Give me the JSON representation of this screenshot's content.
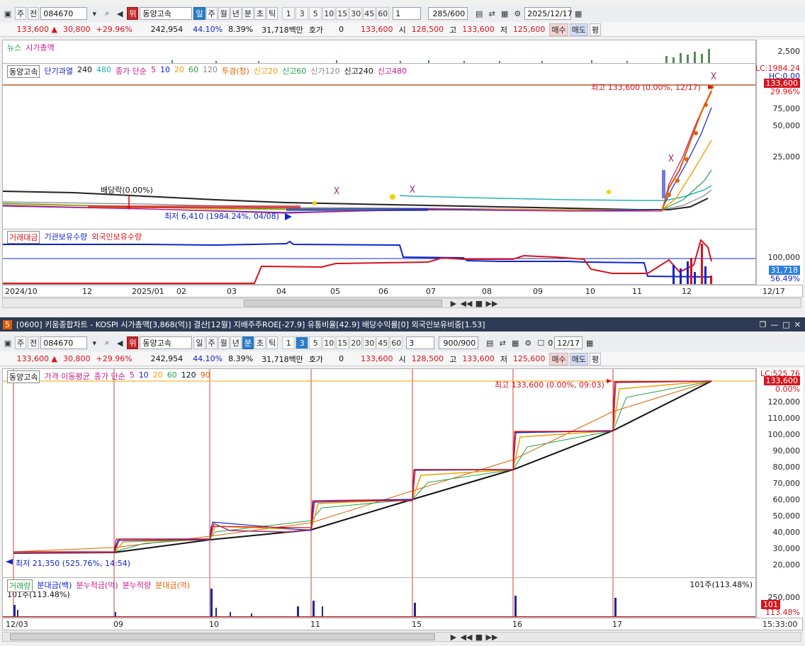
{
  "top": {
    "toolbar": {
      "market": "주",
      "mode": "전",
      "code": "084670",
      "warn": "위",
      "name": "동양고속",
      "periods": [
        "일",
        "주",
        "월",
        "년",
        "분",
        "초",
        "틱"
      ],
      "active_period": "일",
      "nums": [
        "1",
        "3",
        "5",
        "10",
        "15",
        "30",
        "45",
        "60"
      ],
      "interval": "1",
      "count": "285/600",
      "date": "2025/12/17"
    },
    "quote": {
      "price": "133,600",
      "change": "30,800",
      "pct": "+29.96%",
      "volume": "242,954",
      "ratio": "44.10%",
      "turnover": "8.39%",
      "amount": "31,718백만",
      "hoga_label": "호가",
      "hoga": "0",
      "ask": "133,600",
      "open_label": "시",
      "open": "128,500",
      "high_label": "고",
      "high": "133,600",
      "low_label": "저",
      "low": "125,600",
      "buy": "매수",
      "sell": "매도",
      "avg": "평"
    },
    "news_pane": {
      "legend": [
        "뉴스",
        "시가총액"
      ],
      "tick": "2,500"
    },
    "price_pane": {
      "legend": [
        "동양고속",
        "단기과열",
        "240",
        "480",
        "종가 단순",
        "5",
        "10",
        "20",
        "60",
        "120",
        "투경(청)",
        "신고20",
        "신고60",
        "신가120",
        "신고240",
        "신고480"
      ],
      "lc": "LC:1984.24",
      "hc": "HC:0.00",
      "last_price": "133,600",
      "last_pct": "29.96%",
      "ticks": [
        "75,000",
        "50,000",
        "25,000"
      ],
      "high_note": "최고 133,600 (0.00%, 12/17)",
      "low_note": "최저 6,410 (1984.24%, 04/08)",
      "div_note": "배당락(0.00%)"
    },
    "vol_pane": {
      "legend": [
        "거래대금",
        "기관보유수량",
        "외국인보유수량"
      ],
      "tick": "100,000",
      "val1": "31,718",
      "val2": "56.49%"
    },
    "xaxis": [
      "2024/10",
      "12",
      "2025/01",
      "02",
      "03",
      "04",
      "05",
      "06",
      "07",
      "08",
      "09",
      "10",
      "11",
      "12"
    ],
    "xaxis_end": "12/17",
    "colors": {
      "red": "#d8121c",
      "blue": "#1224c8",
      "black": "#111111",
      "teal": "#22b5b5",
      "orange": "#f08a00",
      "green": "#26a04a"
    }
  },
  "window": {
    "badge": "5",
    "title": "[0600] 키움종합차트 - KOSPI 시가총액[3,868(억)] 결산[12월] 지배주주ROE[-27.9] 유통비율[42.9] 배당수익률[0] 외국인보유비중[1.53]"
  },
  "bottom": {
    "toolbar": {
      "market": "주",
      "mode": "전",
      "code": "084670",
      "warn": "위",
      "name": "동양고속",
      "periods": [
        "일",
        "주",
        "월",
        "년",
        "분",
        "초",
        "틱"
      ],
      "active_period": "분",
      "nums": [
        "1",
        "3",
        "5",
        "10",
        "15",
        "20",
        "30",
        "45",
        "60"
      ],
      "active_num": "3",
      "interval": "3",
      "count": "900/900",
      "check_label": "0",
      "date": "12/17"
    },
    "quote": {
      "price": "133,600",
      "change": "30,800",
      "pct": "+29.96%",
      "volume": "242,954",
      "ratio": "44.10%",
      "turnover": "8.39%",
      "amount": "31,718백만",
      "hoga_label": "호가",
      "hoga": "0",
      "ask": "133,600",
      "open_label": "시",
      "open": "128,500",
      "high_label": "고",
      "high": "133,600",
      "low_label": "저",
      "low": "125,600",
      "buy": "매수",
      "sell": "매도",
      "avg": "평"
    },
    "price_pane": {
      "legend": [
        "동양고속",
        "가격 이동평균",
        "종가 단순",
        "5",
        "10",
        "20",
        "60",
        "120",
        "90"
      ],
      "lc": "LC:525.76",
      "last_price": "133,600",
      "last_pct": "0.00%",
      "ticks": [
        "120,000",
        "110,000",
        "100,000",
        "90,000",
        "80,000",
        "70,000",
        "60,000",
        "50,000",
        "40,000",
        "30,000",
        "20,000"
      ],
      "high_note": "최고 133,600 (0.00%, 09:03)",
      "low_note": "최저 21,350 (525.76%, 14:54)"
    },
    "vol_pane": {
      "legend": [
        "거래량",
        "분대금(백)",
        "분누적금(억)",
        "분누적량",
        "분대금(억)"
      ],
      "left_note": "101주(113.48%)",
      "right_note": "101주(113.48%)",
      "tick": "250,000",
      "last": "101",
      "last_pct": "113.48%"
    },
    "xaxis": [
      "12/03",
      "09",
      "10",
      "11",
      "15",
      "16",
      "17"
    ],
    "xaxis_end": "15:33:00"
  }
}
